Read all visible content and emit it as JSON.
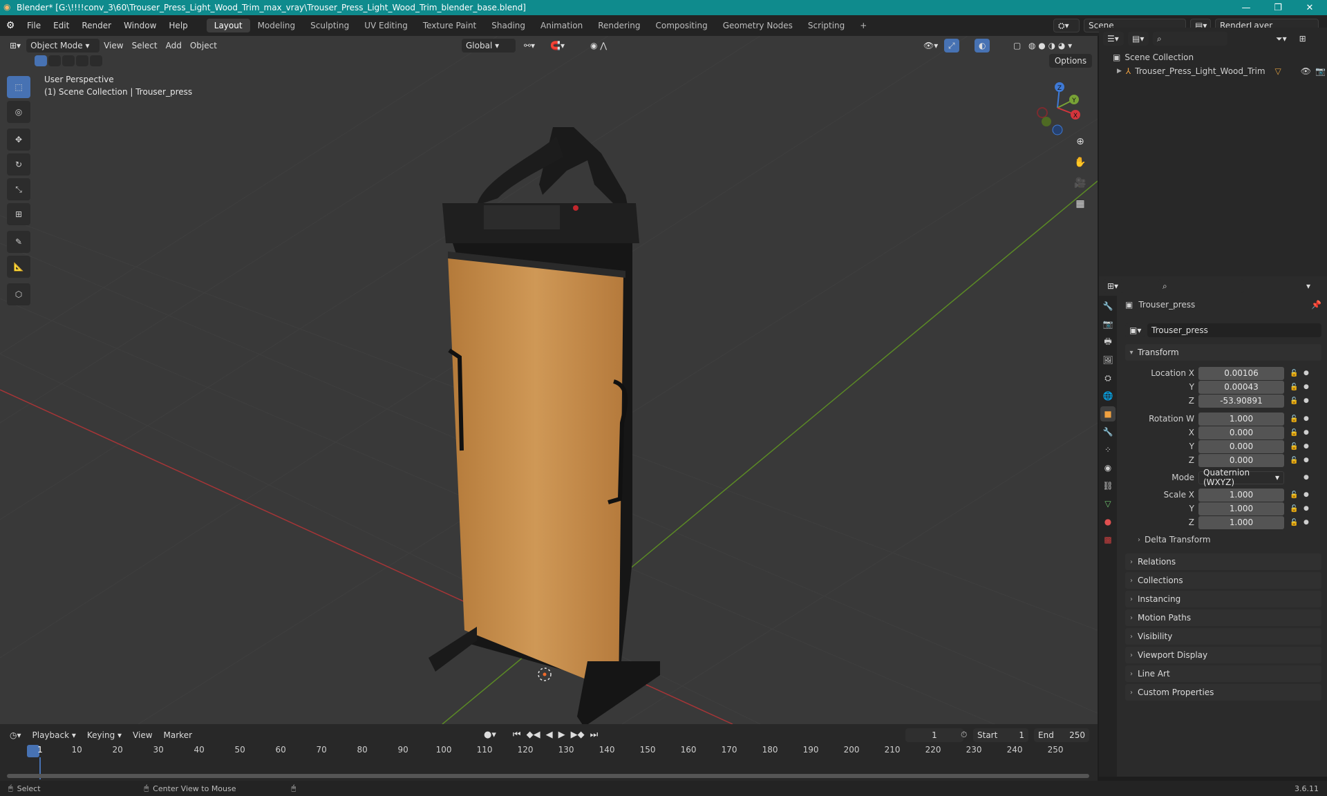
{
  "window": {
    "title": "Blender* [G:\\!!!!conv_3\\60\\Trouser_Press_Light_Wood_Trim_max_vray\\Trouser_Press_Light_Wood_Trim_blender_base.blend]",
    "minimize": "—",
    "restore": "❐",
    "close": "✕"
  },
  "menu": {
    "items": [
      "File",
      "Edit",
      "Render",
      "Window",
      "Help"
    ],
    "workspaces": [
      "Layout",
      "Modeling",
      "Sculpting",
      "UV Editing",
      "Texture Paint",
      "Shading",
      "Animation",
      "Rendering",
      "Compositing",
      "Geometry Nodes",
      "Scripting"
    ],
    "active_workspace": "Layout",
    "add_workspace": "+",
    "scene": "Scene",
    "render_layer": "RenderLayer"
  },
  "viewport": {
    "mode": "Object Mode",
    "menus": [
      "View",
      "Select",
      "Add",
      "Object"
    ],
    "orientation": "Global",
    "options": "Options",
    "overlay_line1": "User Perspective",
    "overlay_line2": "(1) Scene Collection | Trouser_press",
    "gizmo": {
      "z": "Z",
      "y": "Y",
      "x": "X"
    }
  },
  "outliner": {
    "root": "Scene Collection",
    "item": "Trouser_Press_Light_Wood_Trim"
  },
  "properties": {
    "object_name": "Trouser_press",
    "data_name": "Trouser_press",
    "transform_header": "Transform",
    "location": {
      "label_x": "Location X",
      "label_y": "Y",
      "label_z": "Z",
      "x": "0.00106",
      "y": "0.00043",
      "z": "-53.90891"
    },
    "rotation": {
      "label_w": "Rotation W",
      "label_x": "X",
      "label_y": "Y",
      "label_z": "Z",
      "w": "1.000",
      "x": "0.000",
      "y": "0.000",
      "z": "0.000"
    },
    "mode": {
      "label": "Mode",
      "value": "Quaternion (WXYZ)"
    },
    "scale": {
      "label_x": "Scale X",
      "label_y": "Y",
      "label_z": "Z",
      "x": "1.000",
      "y": "1.000",
      "z": "1.000"
    },
    "delta": "Delta Transform",
    "panels": [
      "Relations",
      "Collections",
      "Instancing",
      "Motion Paths",
      "Visibility",
      "Viewport Display",
      "Line Art",
      "Custom Properties"
    ]
  },
  "timeline": {
    "menus": [
      "Playback",
      "Keying",
      "View",
      "Marker"
    ],
    "current_frame": "1",
    "start_label": "Start",
    "start": "1",
    "end_label": "End",
    "end": "250",
    "ticks": [
      "1",
      "10",
      "20",
      "30",
      "40",
      "50",
      "60",
      "70",
      "80",
      "90",
      "100",
      "110",
      "120",
      "130",
      "140",
      "150",
      "160",
      "170",
      "180",
      "190",
      "200",
      "210",
      "220",
      "230",
      "240",
      "250"
    ]
  },
  "status": {
    "select": "Select",
    "center_view": "Center View to Mouse",
    "version": "3.6.11"
  },
  "colors": {
    "accent": "#4772b3",
    "titlebar": "#0f8b8d",
    "wood": "#c48a45",
    "x_axis": "#c8393b",
    "y_axis": "#6a9a2a"
  }
}
